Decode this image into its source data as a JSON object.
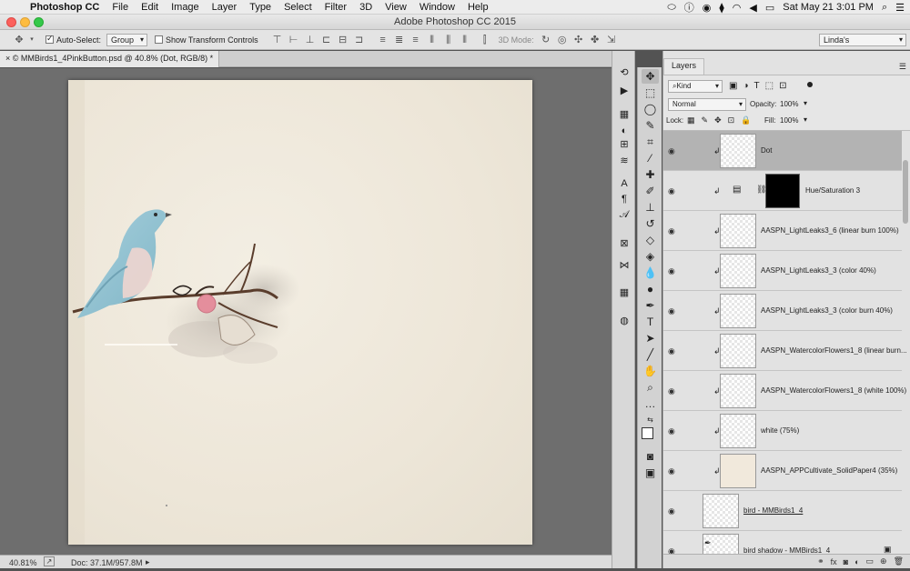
{
  "menubar": {
    "items": [
      "Photoshop CC",
      "File",
      "Edit",
      "Image",
      "Layer",
      "Type",
      "Select",
      "Filter",
      "3D",
      "View",
      "Window",
      "Help"
    ],
    "clock": "Sat May 21  3:01 PM"
  },
  "window": {
    "title": "Adobe Photoshop CC 2015"
  },
  "options": {
    "auto_select_label": "Auto-Select:",
    "auto_select_value": "Group",
    "show_transform_label": "Show Transform Controls",
    "mode_3d_label": "3D Mode:",
    "workspace": "Linda's"
  },
  "document": {
    "tab_label": "© MMBirds1_4PinkButton.psd @ 40.8% (Dot, RGB/8) *"
  },
  "status": {
    "zoom": "40.81%",
    "doc": "Doc: 37.1M/957.8M"
  },
  "layers_panel": {
    "tab": "Layers",
    "filter_kind": "Kind",
    "blend_mode": "Normal",
    "opacity_label": "Opacity:",
    "opacity_value": "100%",
    "lock_label": "Lock:",
    "fill_label": "Fill:",
    "fill_value": "100%",
    "layers": [
      {
        "name": "Dot",
        "selected": true,
        "clipped": true
      },
      {
        "name": "Hue/Saturation 3",
        "clipped": true,
        "adjustment": true
      },
      {
        "name": "AASPN_LightLeaks3_6 (linear burn 100%)",
        "clipped": true
      },
      {
        "name": "AASPN_LightLeaks3_3 (color 40%)",
        "clipped": true
      },
      {
        "name": "AASPN_LightLeaks3_3 (color burn 40%)",
        "clipped": true
      },
      {
        "name": "AASPN_WatercolorFlowers1_8 (linear burn...",
        "clipped": true
      },
      {
        "name": "AASPN_WatercolorFlowers1_8 (white 100%)",
        "clipped": true
      },
      {
        "name": "white (75%)",
        "clipped": true
      },
      {
        "name": "AASPN_APPCultivate_SolidPaper4 (35%)",
        "clipped": true
      },
      {
        "name": "bird - MMBirds1_4",
        "clipped": false
      },
      {
        "name": "bird shadow - MMBirds1_4",
        "clipped": false
      }
    ]
  },
  "colors": {
    "accent": "#1a6fd6",
    "selected_layer": "#b3b3b3",
    "paper": "#ede6d8"
  }
}
